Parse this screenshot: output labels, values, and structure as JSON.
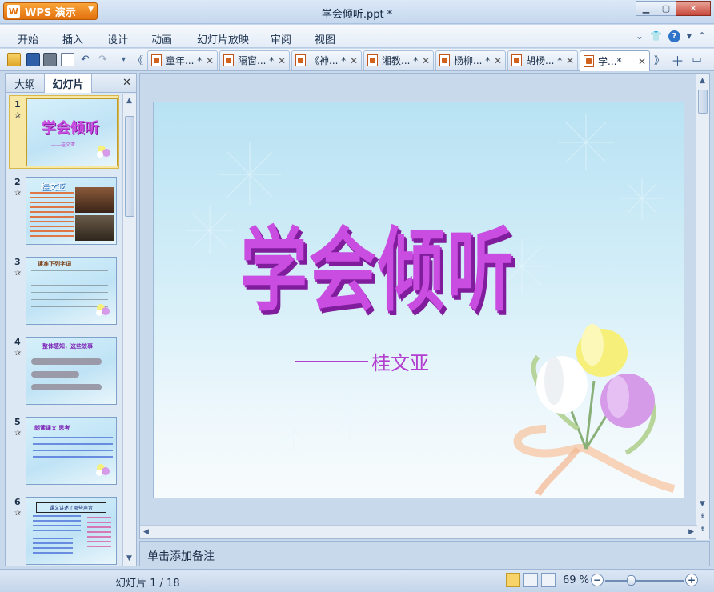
{
  "app": {
    "button_label": "WPS 演示",
    "document_title": "学会倾听.ppt *"
  },
  "menu": [
    "开始",
    "插入",
    "设计",
    "动画",
    "幻灯片放映",
    "审阅",
    "视图"
  ],
  "doc_tabs": [
    {
      "label": "童年... *"
    },
    {
      "label": "隔窗... *"
    },
    {
      "label": "《神... *"
    },
    {
      "label": "湘教... *"
    },
    {
      "label": "杨柳... *"
    },
    {
      "label": "胡杨... *"
    },
    {
      "label": "学...*"
    }
  ],
  "left_panel": {
    "tabs": [
      "大纲",
      "幻灯片"
    ],
    "active_tab": "幻灯片",
    "thumbnails": [
      {
        "number": "1",
        "title": "学会倾听",
        "subtitle": "——桂文亚"
      },
      {
        "number": "2",
        "title": "桂文亚"
      },
      {
        "number": "3",
        "title": "读准下列字词"
      },
      {
        "number": "4",
        "title": "整体感知，这些故事"
      },
      {
        "number": "5",
        "title": "朗读课文 思考"
      },
      {
        "number": "6",
        "title": "课文讲述了哪些声音"
      }
    ]
  },
  "slide": {
    "title": "学会倾听",
    "subtitle": "桂文亚"
  },
  "notes": {
    "placeholder": "单击添加备注"
  },
  "status": {
    "slide_counter": "幻灯片 1 / 18",
    "zoom": "69 %"
  },
  "colors": {
    "accent": "#e2700d",
    "title_purple": "#c94de0",
    "selection": "#f7e9a5"
  }
}
